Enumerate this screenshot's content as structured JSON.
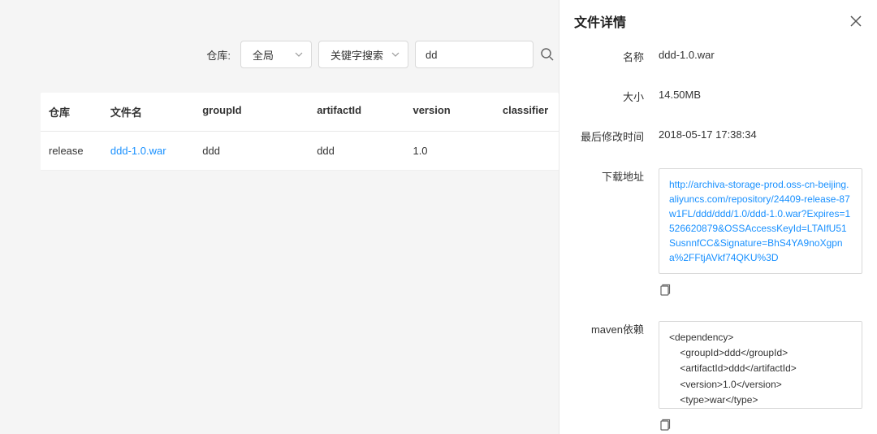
{
  "filter": {
    "label": "仓库:",
    "repo_select": "全局",
    "search_type": "关键字搜索",
    "search_value": "dd"
  },
  "table": {
    "headers": {
      "repo": "仓库",
      "filename": "文件名",
      "groupId": "groupId",
      "artifactId": "artifactId",
      "version": "version",
      "classifier": "classifier"
    },
    "rows": [
      {
        "repo": "release",
        "filename": "ddd-1.0.war",
        "groupId": "ddd",
        "artifactId": "ddd",
        "version": "1.0",
        "classifier": ""
      }
    ]
  },
  "panel": {
    "title": "文件详情",
    "labels": {
      "name": "名称",
      "size": "大小",
      "modified": "最后修改时间",
      "download": "下载地址",
      "maven": "maven依赖"
    },
    "values": {
      "name": "ddd-1.0.war",
      "size": "14.50MB",
      "modified": "2018-05-17 17:38:34",
      "download": "http://archiva-storage-prod.oss-cn-beijing.aliyuncs.com/repository/24409-release-87w1FL/ddd/ddd/1.0/ddd-1.0.war?Expires=1526620879&OSSAccessKeyId=LTAIfU51SusnnfCC&Signature=BhS4YA9noXgpna%2FFtjAVkf74QKU%3D",
      "maven": "<dependency>\n    <groupId>ddd</groupId>\n    <artifactId>ddd</artifactId>\n    <version>1.0</version>\n    <type>war</type>\n</dependency>"
    }
  }
}
